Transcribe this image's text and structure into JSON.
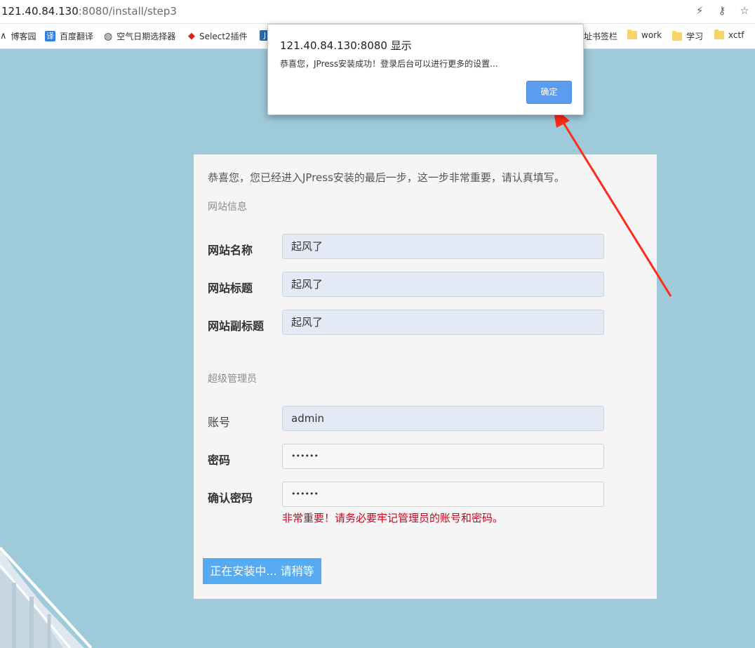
{
  "browser": {
    "url_host": "121.40.84.130",
    "url_rest": ":8080/install/step3",
    "icons": [
      "lightning-icon",
      "key-icon",
      "star-icon"
    ]
  },
  "bookmarks": [
    {
      "label": "博客园",
      "icon": "bookmark-icon"
    },
    {
      "label": "百度翻译",
      "icon": "translate-icon"
    },
    {
      "label": "空气日期选择器",
      "icon": "globe-icon"
    },
    {
      "label": "Select2插件",
      "icon": "select2-icon"
    },
    {
      "label": "址书签栏",
      "icon": "none"
    },
    {
      "label": "work",
      "icon": "folder-icon"
    },
    {
      "label": "学习",
      "icon": "folder-icon"
    },
    {
      "label": "xctf",
      "icon": "folder-icon"
    }
  ],
  "dialog": {
    "title": "121.40.84.130:8080 显示",
    "message": "恭喜您，JPress安装成功！登录后台可以进行更多的设置...",
    "ok_label": "确定"
  },
  "install": {
    "intro": "恭喜您，您已经进入JPress安装的最后一步，这一步非常重要，请认真填写。",
    "site_section": "网站信息",
    "site_name_label": "网站名称",
    "site_name_value": "起风了",
    "site_title_label": "网站标题",
    "site_title_value": "起风了",
    "site_subtitle_label": "网站副标题",
    "site_subtitle_value": "起风了",
    "admin_section": "超级管理员",
    "account_label": "账号",
    "account_value": "admin",
    "password_label": "密码",
    "password_value": "••••••",
    "confirm_label": "确认密码",
    "confirm_value": "••••••",
    "warning": "非常重要！请务必要牢记管理员的账号和密码。",
    "button_label": "正在安装中... 请稍等"
  },
  "colors": {
    "background": "#9fcad9",
    "accent": "#55aaf0",
    "warning": "#d0021b",
    "annotation_arrow": "#ff2a1a"
  }
}
